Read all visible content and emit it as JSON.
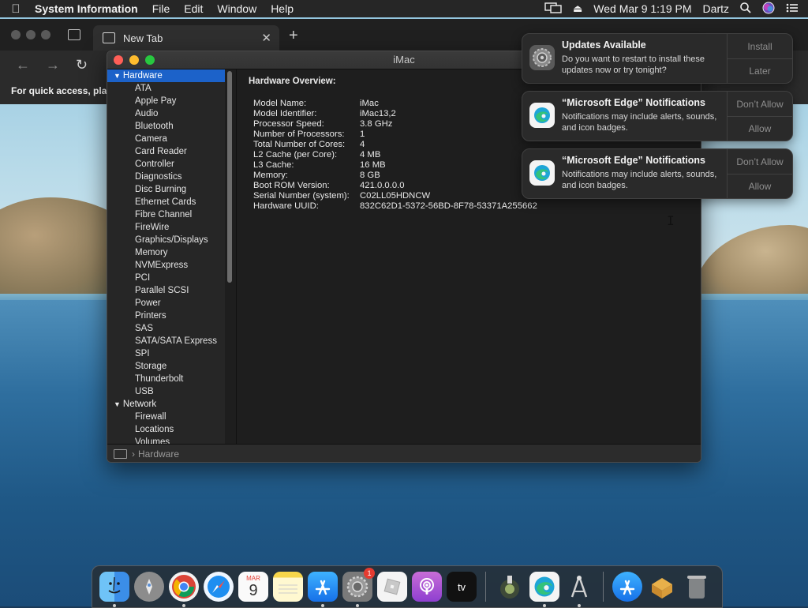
{
  "menubar": {
    "app_name": "System Information",
    "menus": [
      "File",
      "Edit",
      "Window",
      "Help"
    ],
    "datetime": "Wed Mar 9  1:19 PM",
    "user": "Dartz"
  },
  "browser": {
    "tab_title": "New Tab",
    "quick_access_text": "For quick access, pla"
  },
  "window": {
    "title": "iMac",
    "sidebar": {
      "hardware_label": "Hardware",
      "hardware_items": [
        "ATA",
        "Apple Pay",
        "Audio",
        "Bluetooth",
        "Camera",
        "Card Reader",
        "Controller",
        "Diagnostics",
        "Disc Burning",
        "Ethernet Cards",
        "Fibre Channel",
        "FireWire",
        "Graphics/Displays",
        "Memory",
        "NVMExpress",
        "PCI",
        "Parallel SCSI",
        "Power",
        "Printers",
        "SAS",
        "SATA/SATA Express",
        "SPI",
        "Storage",
        "Thunderbolt",
        "USB"
      ],
      "network_label": "Network",
      "network_items": [
        "Firewall",
        "Locations",
        "Volumes"
      ]
    },
    "overview": {
      "heading": "Hardware Overview:",
      "rows": [
        {
          "k": "Model Name:",
          "v": "iMac"
        },
        {
          "k": "Model Identifier:",
          "v": "iMac13,2"
        },
        {
          "k": "Processor Speed:",
          "v": "3.8 GHz"
        },
        {
          "k": "Number of Processors:",
          "v": "1"
        },
        {
          "k": "Total Number of Cores:",
          "v": "4"
        },
        {
          "k": "L2 Cache (per Core):",
          "v": "4 MB"
        },
        {
          "k": "L3 Cache:",
          "v": "16 MB"
        },
        {
          "k": "Memory:",
          "v": "8 GB"
        },
        {
          "k": "Boot ROM Version:",
          "v": "421.0.0.0.0"
        },
        {
          "k": "Serial Number (system):",
          "v": "C02LL05HDNCW"
        },
        {
          "k": "Hardware UUID:",
          "v": "832C62D1-5372-56BD-8F78-53371A255662"
        }
      ]
    },
    "pathbar": {
      "separator": "›",
      "label": "Hardware"
    }
  },
  "notifications": [
    {
      "title": "Updates Available",
      "body": "Do you want to restart to install these updates now or try tonight?",
      "action_top": "Install",
      "action_bottom": "Later",
      "icon": "gear-icon"
    },
    {
      "title": "“Microsoft Edge” Notifications",
      "body": "Notifications may include alerts, sounds, and icon badges.",
      "action_top": "Don’t Allow",
      "action_bottom": "Allow",
      "icon": "edge-icon"
    },
    {
      "title": "“Microsoft Edge” Notifications",
      "body": "Notifications may include alerts, sounds, and icon badges.",
      "action_top": "Don’t Allow",
      "action_bottom": "Allow",
      "icon": "edge-icon"
    }
  ],
  "dock": {
    "calendar_month": "MAR",
    "calendar_day": "9",
    "settings_badge": "1",
    "tv_label": "tv"
  },
  "colors": {
    "selection": "#1c62c9",
    "close": "#ff5f57",
    "minimize": "#febc2e",
    "zoom": "#28c840"
  }
}
